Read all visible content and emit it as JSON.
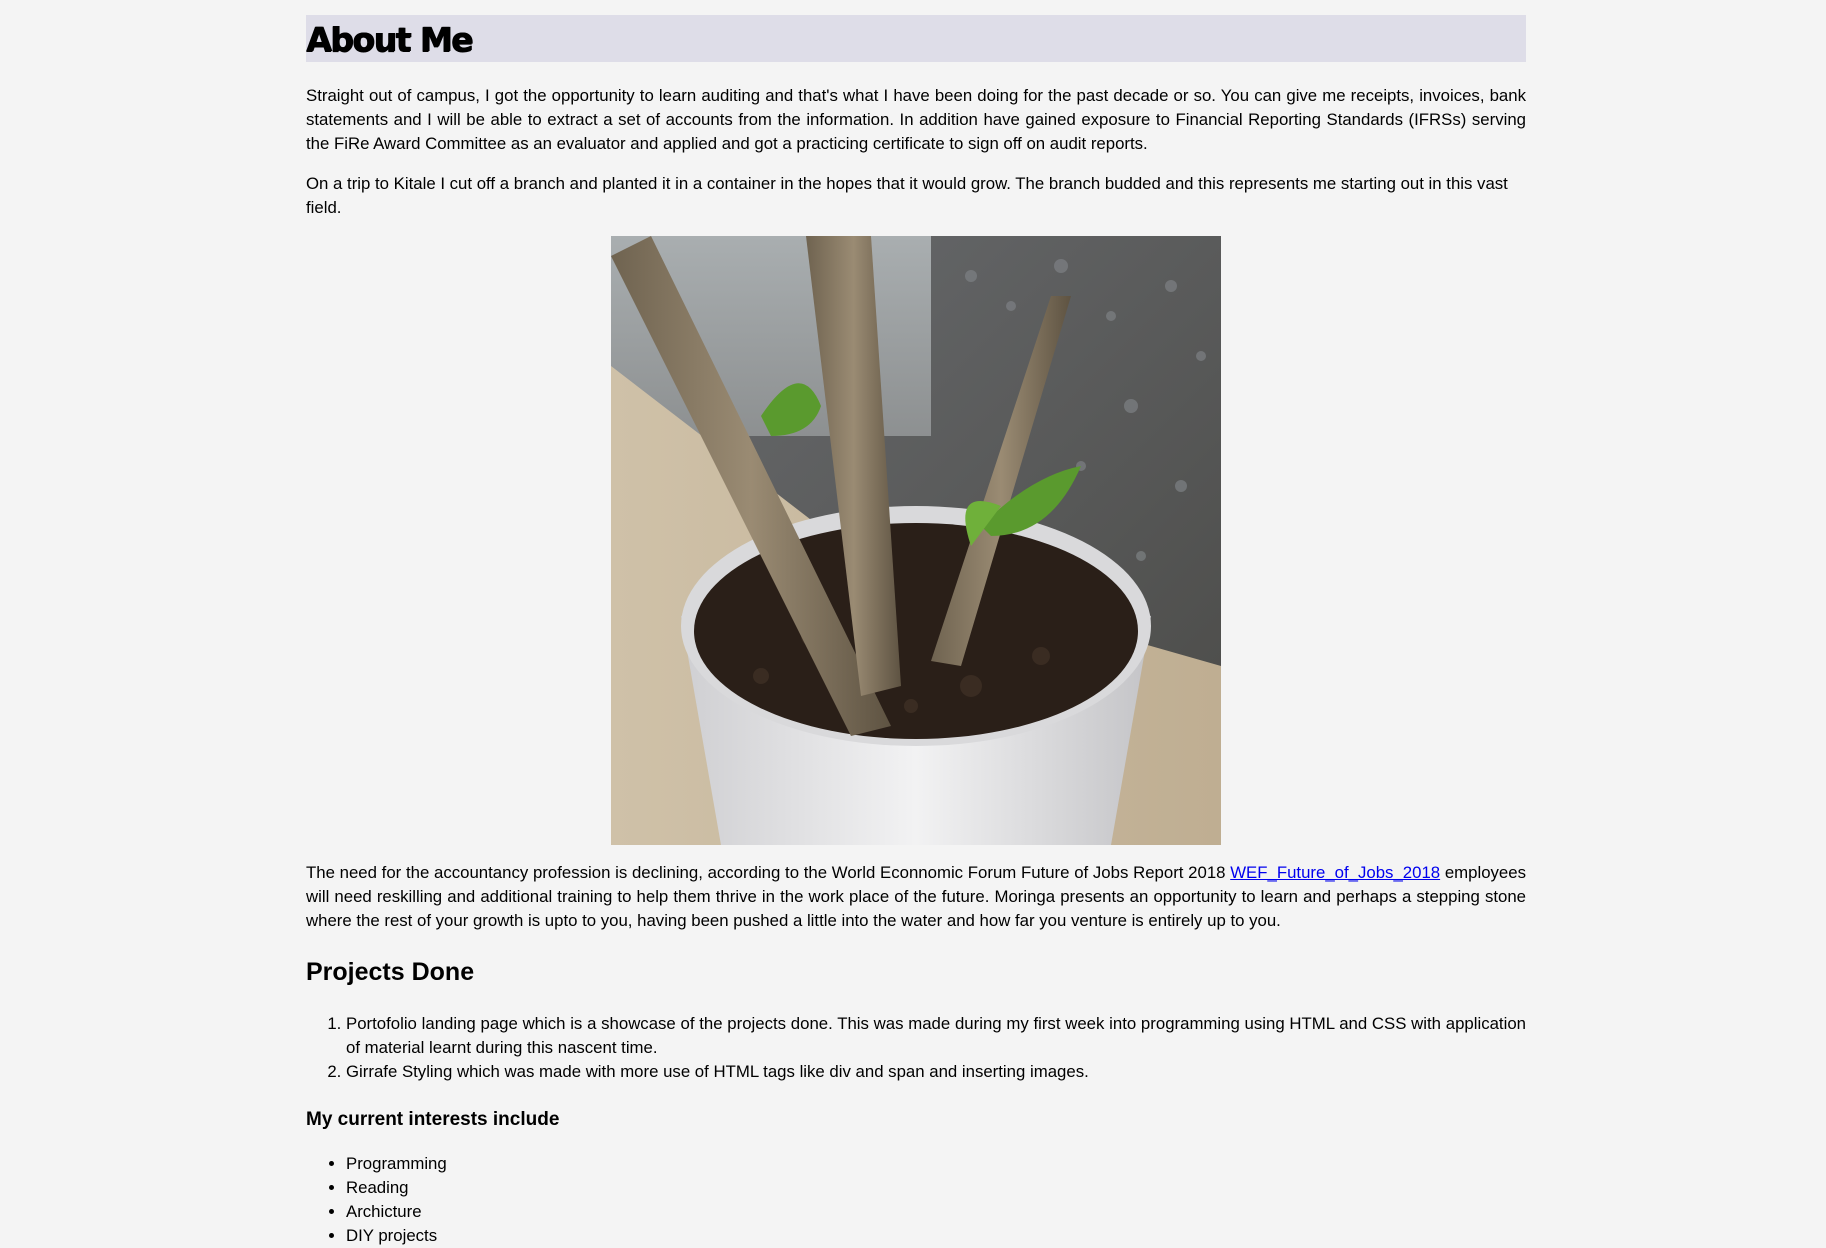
{
  "about": {
    "heading": "About Me",
    "intro_paragraph": "Straight out of campus, I got the opportunity to learn auditing and that's what I have been doing for the past decade or so. You can give me receipts, invoices, bank statements and I will be able to extract a set of accounts from the information. In addition have gained exposure to Financial Reporting Standards (IFRSs) serving the FiRe Award Committee as an evaluator and applied and got a practicing certificate to sign off on audit reports.",
    "kitale_paragraph": "On a trip to Kitale I cut off a branch and planted it in a container in the hopes that it would grow. The branch budded and this represents me starting out in this vast field.",
    "future_paragraph_before_link": "The need for the accountancy profession is declining, according to the World Econnomic Forum Future of Jobs Report 2018 ",
    "future_link_text": "WEF_Future_of_Jobs_2018",
    "future_paragraph_after_link": " employees will need reskilling and additional training to help them thrive in the work place of the future. Moringa presents an opportunity to learn and perhaps a stepping stone where the rest of your growth is upto to you, having been pushed a little into the water and how far you venture is entirely up to you."
  },
  "projects": {
    "heading": "Projects Done",
    "items": [
      "Portofolio landing page which is a showcase of the projects done. This was made during my first week into programming using HTML and CSS with application of material learnt during this nascent time.",
      "Girrafe Styling which was made with more use of HTML tags like div and span and inserting images."
    ]
  },
  "interests": {
    "heading": "My current interests include",
    "items": [
      "Programming",
      "Reading",
      "Archicture",
      "DIY projects"
    ]
  },
  "photo": {
    "icon": "potted-branch-photo"
  }
}
